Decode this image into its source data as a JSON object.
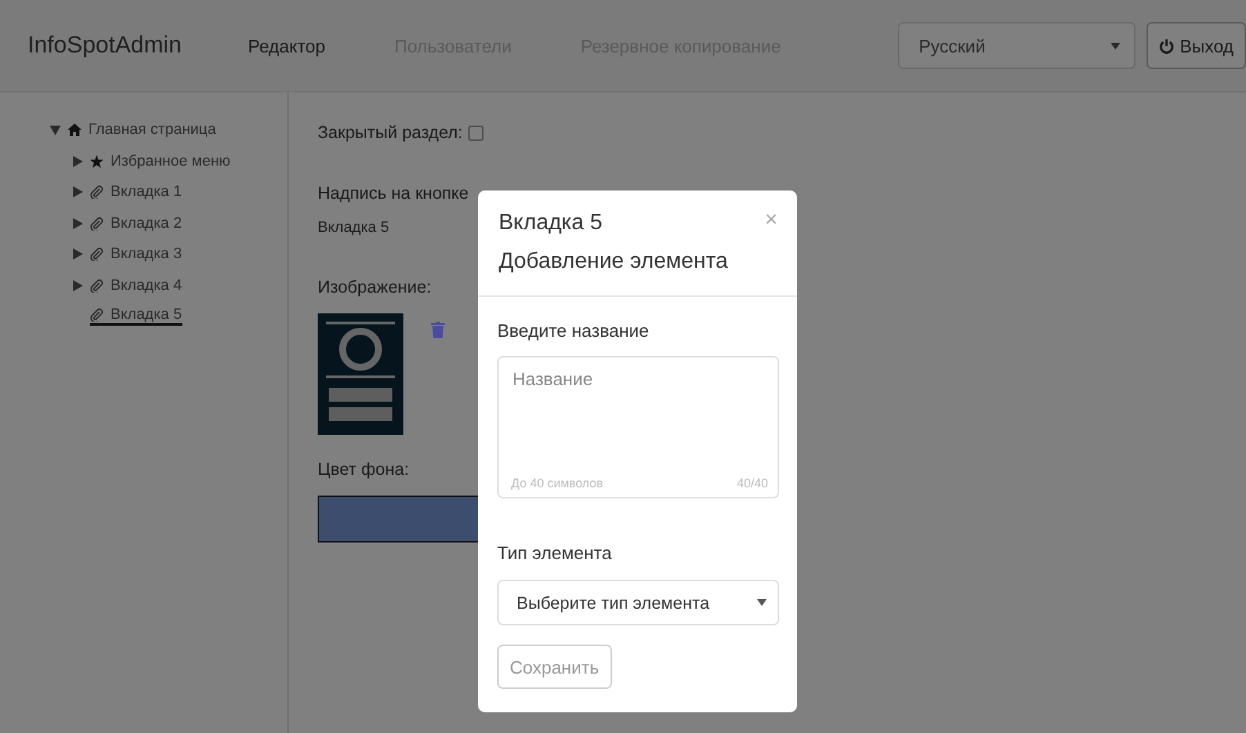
{
  "navbar": {
    "brand": "InfoSpotAdmin",
    "items": [
      {
        "label": "Редактор",
        "selected": true
      },
      {
        "label": "Пользователи",
        "selected": false
      },
      {
        "label": "Резервное копирование",
        "selected": false
      }
    ],
    "language": "Русский",
    "logout": "Выход"
  },
  "tree": [
    {
      "label": "Главная страница",
      "kind": "home",
      "expanded": true,
      "selected": false,
      "children": [
        {
          "label": "Избранное меню",
          "kind": "star",
          "expanded": false,
          "selected": false
        },
        {
          "label": "Вкладка 1",
          "kind": "clip",
          "expanded": false,
          "selected": false
        },
        {
          "label": "Вкладка 2",
          "kind": "clip",
          "expanded": false,
          "selected": false
        },
        {
          "label": "Вкладка 3",
          "kind": "clip",
          "expanded": false,
          "selected": false
        },
        {
          "label": "Вкладка 4",
          "kind": "clip",
          "expanded": false,
          "selected": false
        },
        {
          "label": "Вкладка 5",
          "kind": "clip",
          "selected": true
        }
      ]
    }
  ],
  "editor": {
    "closed_section": {
      "label": "Закрытый раздел:",
      "checked": false
    },
    "button_caption": {
      "label": "Надпись на кнопке",
      "value": "Вкладка 5"
    },
    "image": {
      "label": "Изображение:",
      "kind": "picture"
    },
    "background_color": {
      "label": "Цвет фона:",
      "color": "#3d4d6e"
    }
  },
  "modal": {
    "title": "Вкладка 5",
    "subtitle": "Добавление элемента",
    "close": "×",
    "name_label": "Введите название",
    "name_placeholder": "Название",
    "name_hint": "До 40 символов",
    "name_counter": "40/40",
    "type_label": "Тип элемента",
    "type_select": "Выберите тип элемента",
    "save": "Сохранить"
  }
}
